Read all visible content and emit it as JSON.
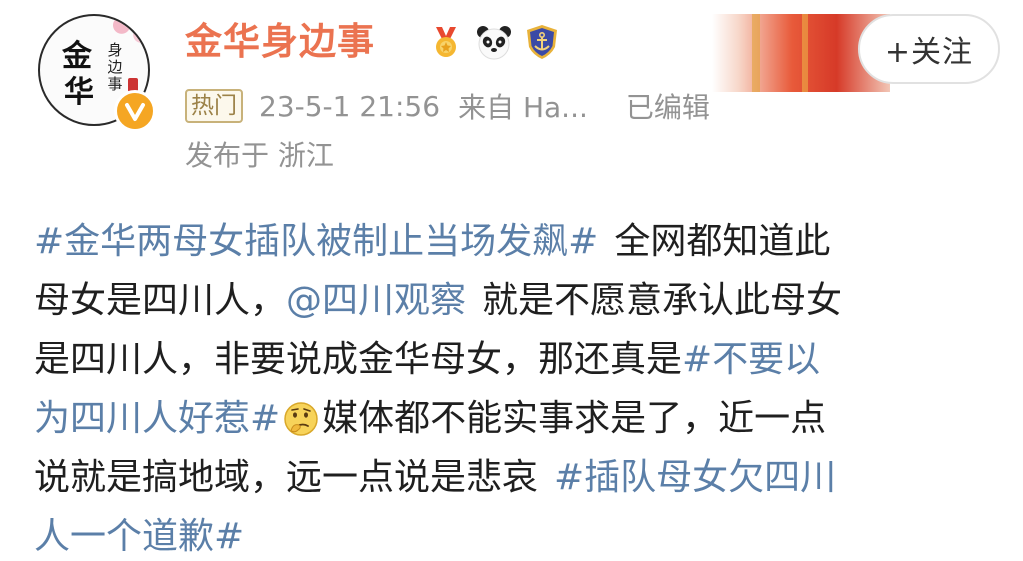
{
  "header": {
    "username": "金华身边事",
    "avatar_text": {
      "big": [
        "金",
        "华"
      ],
      "small": "身边事"
    },
    "badges": [
      "medal-icon",
      "panda-icon",
      "anchor-shield-icon"
    ],
    "follow_label": "+关注",
    "hot_tag": "热门",
    "timestamp": "23-5-1 21:56",
    "source": "来自 Ha...",
    "edited": "已编辑",
    "location": "发布于 浙江"
  },
  "post": {
    "l1": {
      "topic": "#金华两母女插队被制止当场发飙#",
      "text": "全网都知道此"
    },
    "l2": {
      "text_a": "母女是四川人，",
      "mention": "@四川观察",
      "text_b": "就是不愿意承认此母女"
    },
    "l3": {
      "text": "是四川人，非要说成金华母女，那还真是",
      "topic_a": "#不要以"
    },
    "l4": {
      "topic_b": "为四川人好惹#",
      "emoji": "thinking-face-emoji",
      "text": "媒体都不能实事求是了，近一点"
    },
    "l5": {
      "text": "说就是搞地域，远一点说是悲哀",
      "topic_a": "#插队母女欠四川"
    },
    "l6": {
      "topic_b": "人一个道歉#"
    }
  },
  "colors": {
    "username": "#eb7350",
    "topic": "#5b7fa8",
    "meta": "#939393",
    "verified": "#f5a623"
  }
}
